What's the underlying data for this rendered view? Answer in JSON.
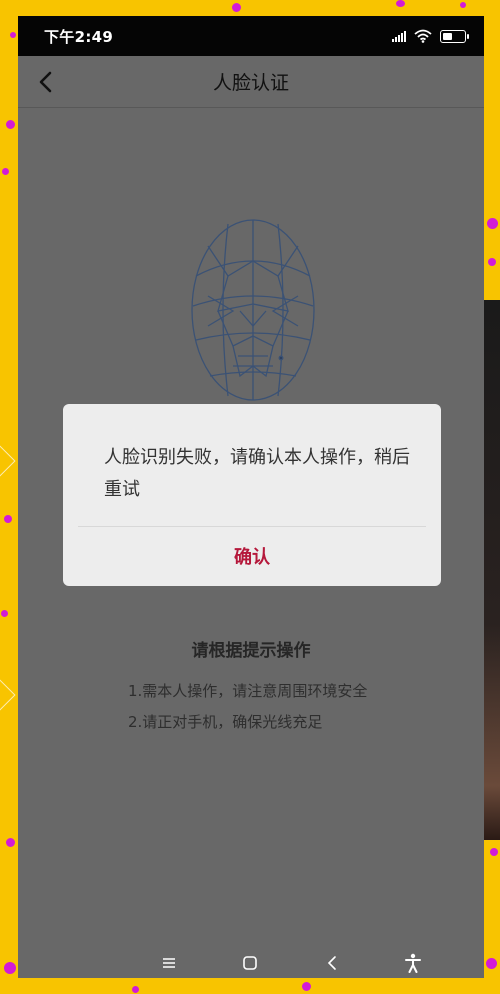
{
  "status_bar": {
    "time": "下午2:49",
    "icons": [
      "signal-icon",
      "wifi-icon",
      "battery-icon"
    ]
  },
  "header": {
    "title": "人脸认证",
    "back_icon": "back-arrow-icon"
  },
  "dialog": {
    "message": "人脸识别失败，请确认本人操作，稍后重试",
    "confirm_label": "确认",
    "confirm_color": "#b5183b"
  },
  "guide": {
    "title": "请根据提示操作",
    "items": [
      "1.需本人操作，请注意周围环境安全",
      "2.请正对手机，确保光线充足"
    ]
  },
  "system_nav": {
    "icons": [
      "menu-icon",
      "home-icon",
      "back-icon",
      "accessibility-icon"
    ]
  },
  "colors": {
    "overlay_bg": "#686868",
    "frame": "#f8c400",
    "mesh": "#3b5275"
  }
}
